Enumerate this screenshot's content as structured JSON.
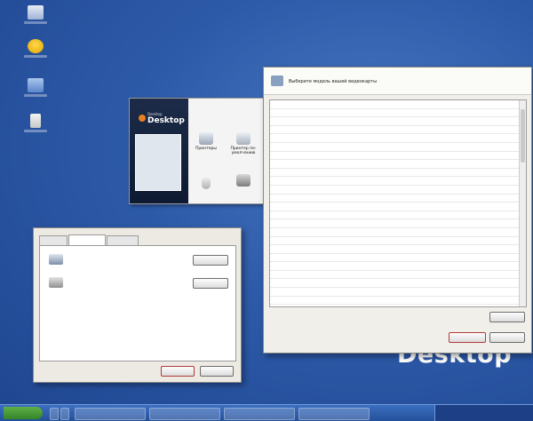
{
  "desktop": {
    "watermark": "Desktop",
    "icons": [
      "my-computer",
      "my-documents",
      "network-places",
      "recycle-bin"
    ]
  },
  "control_panel": {
    "logo_sub": "Desktop",
    "logo_main": "Desktop",
    "items": [
      "Принтеры",
      "Принтер по-умолчанию",
      "",
      ""
    ]
  },
  "properties_dialog": {
    "tabs": [
      "",
      "",
      ""
    ],
    "rows": [
      {
        "label": "",
        "button": ""
      },
      {
        "label": "",
        "button": ""
      }
    ],
    "buttons": {
      "ok": "",
      "cancel": ""
    }
  },
  "card_dialog": {
    "title": "Выберите модель вашей видеокарты",
    "items": [
      "",
      "",
      "",
      "",
      "",
      "",
      "",
      "",
      "",
      "",
      "",
      "",
      "",
      "",
      "",
      "",
      "",
      "",
      "",
      "",
      "",
      "",
      "",
      "",
      "",
      "",
      ""
    ],
    "buttons": {
      "action": "",
      "ok": "",
      "cancel": ""
    }
  },
  "colors": {
    "desktop": "#2d5aa8",
    "taskbar": "#24509a",
    "start": "#34842a",
    "accent_red": "#b23a3a"
  }
}
